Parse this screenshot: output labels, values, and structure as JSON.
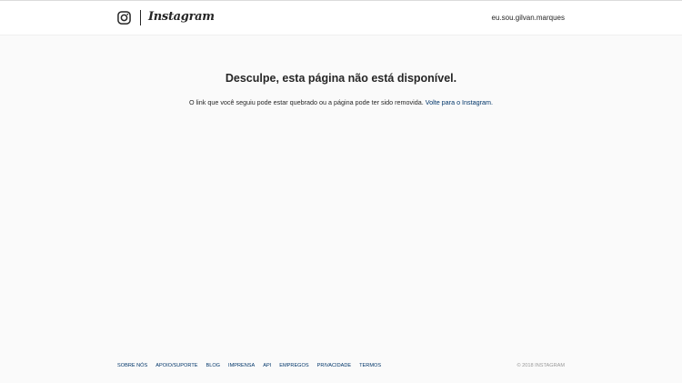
{
  "header": {
    "brand": "Instagram",
    "username": "eu.sou.gilvan.marques"
  },
  "main": {
    "title": "Desculpe, esta página não está disponível.",
    "message": "O link que você seguiu pode estar quebrado ou a página pode ter sido removida.",
    "back_link": "Volte para o Instagram."
  },
  "footer": {
    "links": [
      "Sobre nós",
      "Apoio/Suporte",
      "Blog",
      "Imprensa",
      "API",
      "Empregos",
      "Privacidade",
      "Termos"
    ],
    "copyright": "© 2018 Instagram"
  },
  "colors": {
    "background": "#fafafa",
    "link": "#003569",
    "text": "#262626",
    "muted": "#999999"
  },
  "icons": {
    "logo": "instagram-camera-icon"
  }
}
